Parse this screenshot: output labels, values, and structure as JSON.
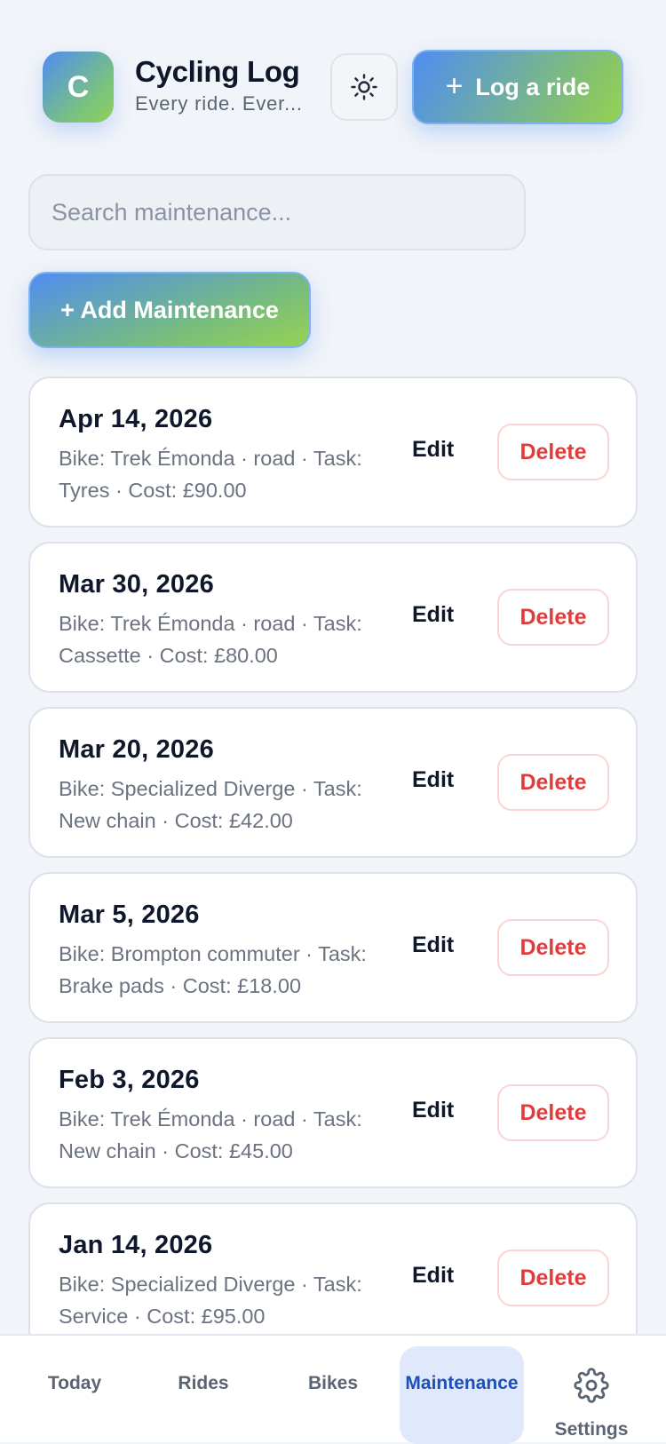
{
  "header": {
    "logo_letter": "C",
    "title": "Cycling Log",
    "subtitle": "Every ride. Ever...",
    "theme_icon": "sun-icon",
    "log_button_label": "Log a ride",
    "log_button_icon": "+"
  },
  "search": {
    "placeholder": "Search maintenance..."
  },
  "add_button_label": "+ Add Maintenance",
  "maintenance": {
    "edit_label": "Edit",
    "delete_label": "Delete",
    "items": [
      {
        "date": "Apr 14, 2026",
        "desc": "Bike: Trek Émonda · road · Task: Tyres · Cost: £90.00"
      },
      {
        "date": "Mar 30, 2026",
        "desc": "Bike: Trek Émonda · road · Task: Cassette · Cost: £80.00"
      },
      {
        "date": "Mar 20, 2026",
        "desc": "Bike: Specialized Diverge · Task: New chain · Cost: £42.00"
      },
      {
        "date": "Mar 5, 2026",
        "desc": "Bike: Brompton commuter · Task: Brake pads · Cost: £18.00"
      },
      {
        "date": "Feb 3, 2026",
        "desc": "Bike: Trek Émonda · road · Task: New chain · Cost: £45.00"
      },
      {
        "date": "Jan 14, 2026",
        "desc": "Bike: Specialized Diverge · Task: Service · Cost: £95.00"
      }
    ]
  },
  "nav": {
    "items": [
      {
        "label": "Today"
      },
      {
        "label": "Rides"
      },
      {
        "label": "Bikes"
      },
      {
        "label": "Maintenance",
        "active": true
      },
      {
        "label": "Settings",
        "icon": "gear-icon"
      }
    ]
  },
  "colors": {
    "accent_blue": "#4f8df2",
    "accent_green": "#96d253",
    "danger": "#e23b3b",
    "active_nav_bg": "#dfe9fb",
    "active_nav_text": "#1e4fb8"
  }
}
